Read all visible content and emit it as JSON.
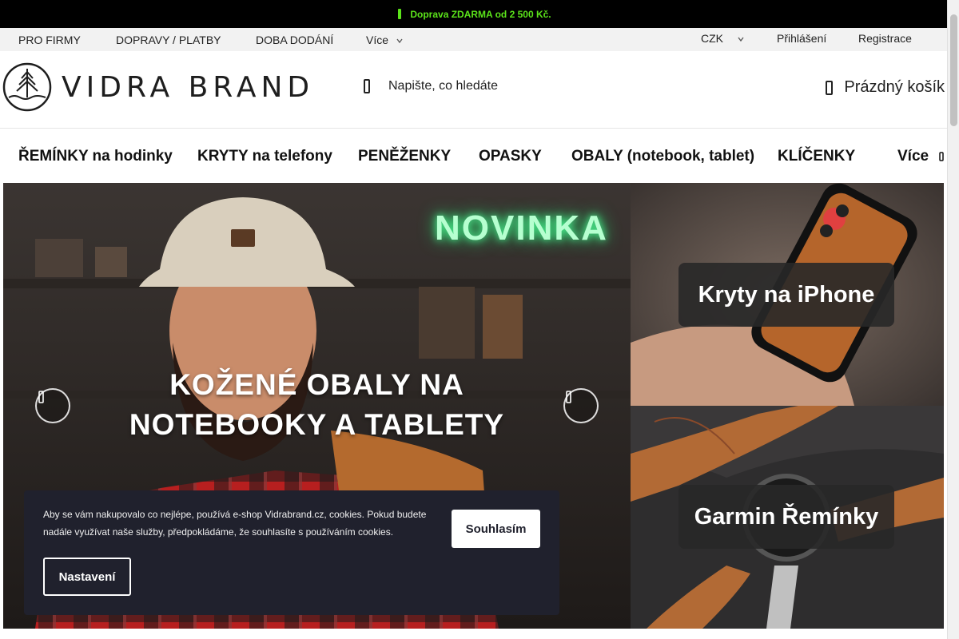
{
  "promo": {
    "text": "Doprava ZDARMA od 2 500 Kč.",
    "icon": "truck-icon",
    "color": "#5be31a"
  },
  "topbar": {
    "links": [
      "PRO FIRMY",
      "DOPRAVY / PLATBY",
      "DOBA DODÁNÍ"
    ],
    "more_label": "Více",
    "currency": "CZK",
    "login": "Přihlášení",
    "register": "Registrace"
  },
  "header": {
    "logo_text": "VIDRA BRAND",
    "search_placeholder": "Napište, co hledáte",
    "cart_label": "Prázdný košík"
  },
  "menu": {
    "items": [
      "ŘEMÍNKY na hodinky",
      "KRYTY na telefony",
      "PENĚŽENKY",
      "OPASKY",
      "OBALY (notebook, tablet)",
      "KLÍČENKY"
    ],
    "more_label": "Více"
  },
  "hero": {
    "badge": "NOVINKA",
    "headline_line1": "KOŽENÉ OBALY NA",
    "headline_line2": "NOTEBOOKY A TABLETY"
  },
  "tiles": [
    {
      "label": "Kryty na iPhone"
    },
    {
      "label": "Garmin Řemínky"
    }
  ],
  "cookie": {
    "message": "Aby se vám nakupovalo co nejlépe, používá e-shop Vidrabrand.cz, cookies. Pokud budete nadále využívat naše služby, předpokládáme, že souhlasíte s používáním cookies.",
    "accept_label": "Souhlasím",
    "settings_label": "Nastavení"
  }
}
